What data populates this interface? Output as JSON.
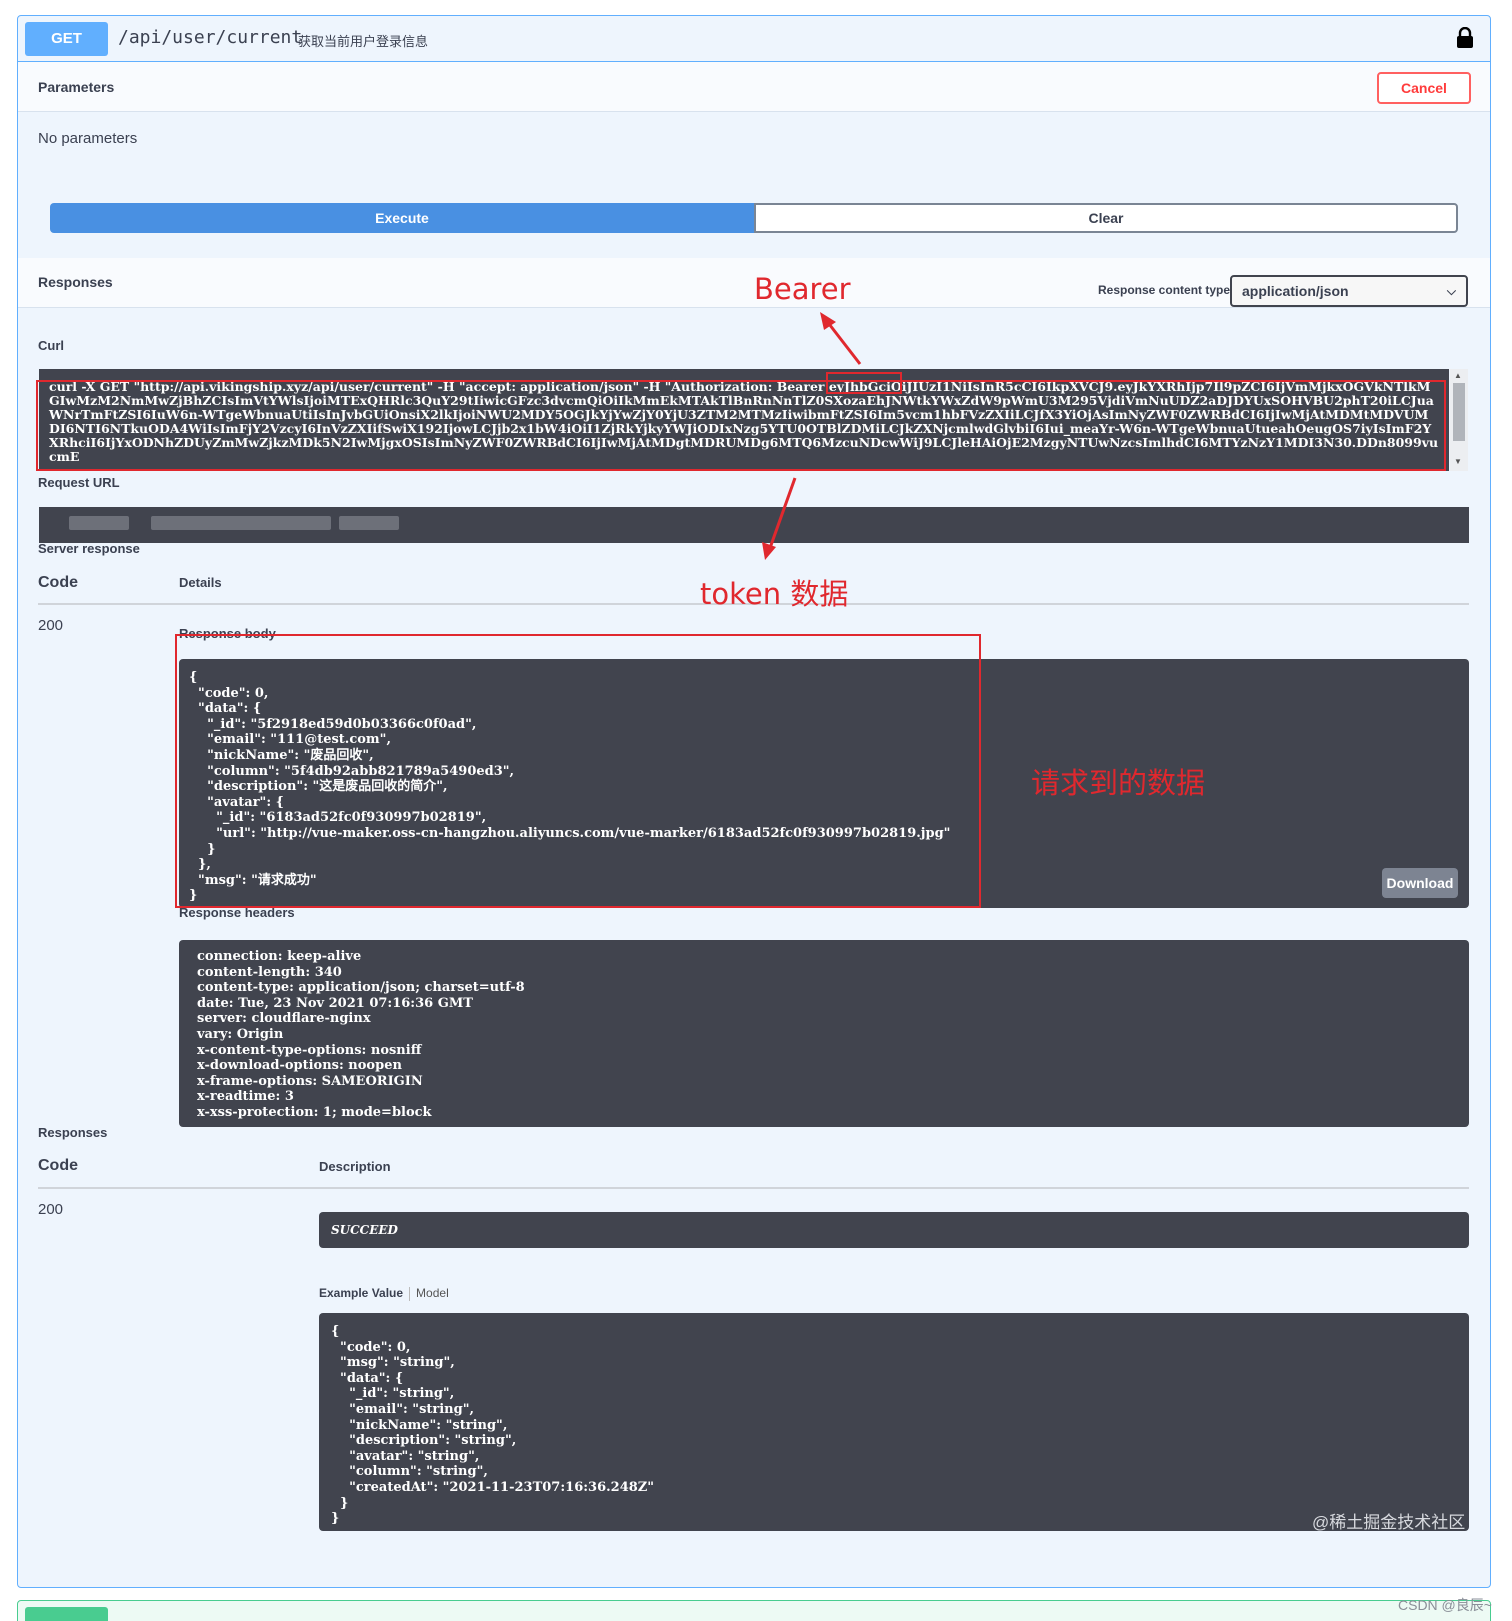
{
  "operation": {
    "method": "GET",
    "path": "/api/user/current",
    "summary": "获取当前用户登录信息"
  },
  "parameters": {
    "title": "Parameters",
    "cancel_label": "Cancel",
    "empty_text": "No parameters"
  },
  "actions": {
    "execute_label": "Execute",
    "clear_label": "Clear"
  },
  "responses_header": {
    "title": "Responses",
    "content_type_label": "Response content type",
    "content_type_value": "application/json"
  },
  "curl": {
    "label": "Curl",
    "command": "curl -X GET \"http://api.vikingship.xyz/api/user/current\" -H \"accept: application/json\" -H \"Authorization: Bearer eyJhbGciOiJIUzI1NiIsInR5cCI6IkpXVCJ9.eyJkYXRhIjp7Il9pZCI6IjVmMjkxOGVkNTlkMGIwMzM2NmMwZjBhZCIsImVtYWlsIjoiMTExQHRlc3QuY29tIiwicGFzc3dvcmQiOiIkMmEkMTAkTlBnRnNnTlZ0SXozaEhJNWtkYWxZdW9pWmU3M295VjdiVmNuUDZ2aDJDYUxSOHVBU2phT20iLCJuaWNrTmFtZSI6IuW6n-WTgeWbnuaUtiIsInJvbGUiOnsiX2lkIjoiNWU2MDY5OGJkYjYwZjY0YjU3ZTM2MTMzIiwibmFtZSI6Im5vcm1hbFVzZXIiLCJfX3YiOjAsImNyZWF0ZWRBdCI6IjIwMjAtMDMtMDVUMDI6NTI6NTkuODA4WiIsImFjY2VzcyI6InVzZXIifSwiX192IjowLCJjb2x1bW4iOiI1ZjRkYjkyYWJiODIxNzg5YTU0OTBlZDMiLCJkZXNjcmlwdGlvbiI6Iui_meaYr-W6n-WTgeWbnuaUtueahOeugOS7iyIsImF2YXRhciI6IjYxODNhZDUyZmMwZjkzMDk5N2IwMjgxOSIsImNyZWF0ZWRBdCI6IjIwMjAtMDgtMDRUMDg6MTQ6MzcuNDcwWiJ9LCJleHAiOjE2MzgyNTUwNzcsImlhdCI6MTYzNzY1MDI3N30.DDn8099vucmE",
    "request_url_label": "Request URL"
  },
  "server_response": {
    "label": "Server response",
    "code_header": "Code",
    "details_header": "Details",
    "status": "200",
    "body_label": "Response body",
    "body": "{\n  \"code\": 0,\n  \"data\": {\n    \"_id\": \"5f2918ed59d0b03366c0f0ad\",\n    \"email\": \"111@test.com\",\n    \"nickName\": \"废品回收\",\n    \"column\": \"5f4db92abb821789a5490ed3\",\n    \"description\": \"这是废品回收的简介\",\n    \"avatar\": {\n      \"_id\": \"6183ad52fc0f930997b02819\",\n      \"url\": \"http://vue-maker.oss-cn-hangzhou.aliyuncs.com/vue-marker/6183ad52fc0f930997b02819.jpg\"\n    }\n  },\n  \"msg\": \"请求成功\"\n}",
    "download_label": "Download",
    "headers_label": "Response headers",
    "headers": "connection: keep-alive\ncontent-length: 340\ncontent-type: application/json; charset=utf-8\ndate: Tue, 23 Nov 2021 07:16:36 GMT\nserver: cloudflare-nginx\nvary: Origin\nx-content-type-options: nosniff\nx-download-options: noopen\nx-frame-options: SAMEORIGIN\nx-readtime: 3\nx-xss-protection: 1; mode=block"
  },
  "responses": {
    "label": "Responses",
    "code_header": "Code",
    "description_header": "Description",
    "status": "200",
    "description": "SUCCEED",
    "tab_example": "Example Value",
    "tab_model": "Model",
    "example": "{\n  \"code\": 0,\n  \"msg\": \"string\",\n  \"data\": {\n    \"_id\": \"string\",\n    \"email\": \"string\",\n    \"nickName\": \"string\",\n    \"description\": \"string\",\n    \"avatar\": \"string\",\n    \"column\": \"string\",\n    \"createdAt\": \"2021-11-23T07:16:36.248Z\"\n  }\n}"
  },
  "annotations": {
    "bearer": "Bearer",
    "token": "token 数据",
    "data": "请求到的数据",
    "color": "#e0282e"
  },
  "watermark": {
    "juejin": "@稀土掘金技术社区",
    "csdn": "CSDN @良辰~"
  },
  "colors": {
    "get_method": "#61affe",
    "execute": "#4990e2",
    "cancel": "#ff6060",
    "dark_panel": "#41444e"
  }
}
